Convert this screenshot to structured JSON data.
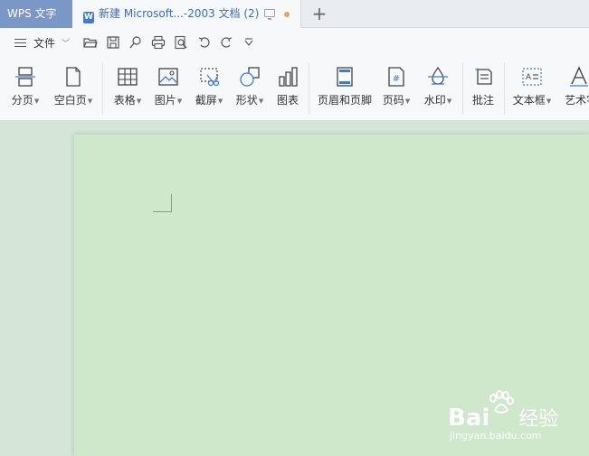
{
  "tabbar": {
    "app_tab": "WPS 文字",
    "doc_tab": "新建 Microsoft...-2003 文档 (2)",
    "doc_icon_letter": "W",
    "new_tab": "+"
  },
  "quick_access": {
    "file_label": "文件",
    "icons": [
      "open-folder-icon",
      "save-icon",
      "print-preview-icon",
      "print-icon",
      "find-icon",
      "undo-icon",
      "redo-icon",
      "customize-icon"
    ]
  },
  "ribbon": {
    "items": [
      {
        "label": "分页",
        "dropdown": true
      },
      {
        "label": "空白页",
        "dropdown": true
      },
      {
        "label": "表格",
        "dropdown": true
      },
      {
        "label": "图片",
        "dropdown": true
      },
      {
        "label": "截屏",
        "dropdown": true
      },
      {
        "label": "形状",
        "dropdown": true
      },
      {
        "label": "图表",
        "dropdown": false
      },
      {
        "label": "页眉和页脚",
        "dropdown": false
      },
      {
        "label": "页码",
        "dropdown": true
      },
      {
        "label": "水印",
        "dropdown": true
      },
      {
        "label": "批注",
        "dropdown": false
      },
      {
        "label": "文本框",
        "dropdown": true
      },
      {
        "label": "艺术字",
        "dropdown": false
      }
    ]
  },
  "watermark": {
    "brand": "Bai",
    "brand2": "经验",
    "url": "jingyan.baidu.com"
  },
  "colors": {
    "app_tab": "#7b97c8",
    "accent": "#3a7be0",
    "page_bg": "#cfe8cc",
    "workspace_bg": "#d5e6d8",
    "unsaved_dot": "#f0a54a"
  }
}
